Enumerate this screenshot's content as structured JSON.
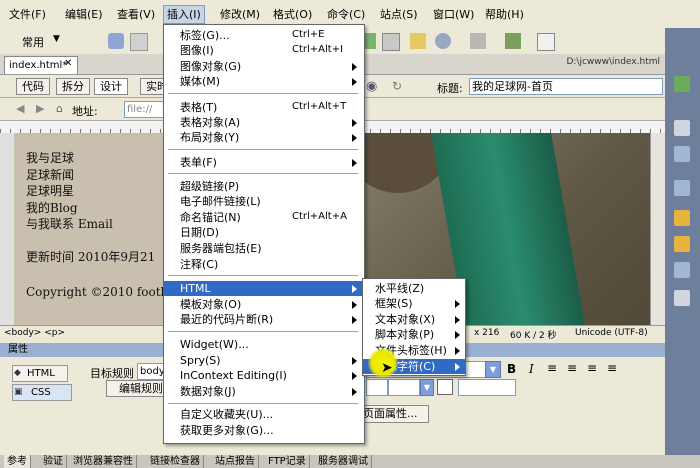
{
  "menubar": {
    "items": [
      "文件(F)",
      "编辑(E)",
      "查看(V)",
      "插入(I)",
      "修改(M)",
      "格式(O)",
      "命令(C)",
      "站点(S)",
      "窗口(W)",
      "帮助(H)"
    ]
  },
  "toolbar": {
    "category": "常用"
  },
  "document": {
    "tab": "index.html*",
    "path": "D:\\jcwww\\index.html"
  },
  "view": {
    "code": "代码",
    "split": "拆分",
    "design": "设计",
    "live": "实时",
    "title_label": "标题:",
    "title_value": "我的足球网-首页"
  },
  "address": {
    "label": "地址:",
    "value": "file://"
  },
  "page": {
    "nav": [
      "我与足球",
      "足球新闻",
      "足球明星",
      "我的Blog",
      "与我联系 Email"
    ],
    "update": "更新时间 2010年9月21",
    "copyright": "Copyright ©2010 football"
  },
  "status": {
    "tag_path": "<body> <p>",
    "size": "x 216",
    "weight": "60 K / 2 秒",
    "encoding": "Unicode (UTF-8)"
  },
  "properties": {
    "header": "属性",
    "html": "HTML",
    "css": "CSS",
    "target_rule_label": "目标规则",
    "target_rule_value": "body",
    "edit_rule": "编辑规则",
    "page_props": "页面属性..."
  },
  "insert_menu": {
    "items": [
      {
        "label": "标签(G)...",
        "shortcut": "Ctrl+E"
      },
      {
        "label": "图像(I)",
        "shortcut": "Ctrl+Alt+I"
      },
      {
        "label": "图像对象(G)",
        "submenu": true
      },
      {
        "label": "媒体(M)",
        "submenu": true
      },
      {
        "label": "表格(T)",
        "shortcut": "Ctrl+Alt+T"
      },
      {
        "label": "表格对象(A)",
        "submenu": true
      },
      {
        "label": "布局对象(Y)",
        "submenu": true
      },
      {
        "label": "表单(F)",
        "submenu": true
      },
      {
        "label": "超级链接(P)"
      },
      {
        "label": "电子邮件链接(L)"
      },
      {
        "label": "命名锚记(N)",
        "shortcut": "Ctrl+Alt+A"
      },
      {
        "label": "日期(D)"
      },
      {
        "label": "服务器端包括(E)"
      },
      {
        "label": "注释(C)"
      },
      {
        "label": "HTML",
        "submenu": true
      },
      {
        "label": "模板对象(O)",
        "submenu": true
      },
      {
        "label": "最近的代码片断(R)",
        "submenu": true
      },
      {
        "label": "Widget(W)..."
      },
      {
        "label": "Spry(S)",
        "submenu": true
      },
      {
        "label": "InContext Editing(I)",
        "submenu": true
      },
      {
        "label": "数据对象(J)",
        "submenu": true
      },
      {
        "label": "自定义收藏夹(U)..."
      },
      {
        "label": "获取更多对象(G)..."
      }
    ]
  },
  "html_submenu": {
    "items": [
      {
        "label": "水平线(Z)"
      },
      {
        "label": "框架(S)",
        "submenu": true
      },
      {
        "label": "文本对象(X)",
        "submenu": true
      },
      {
        "label": "脚本对象(P)",
        "submenu": true
      },
      {
        "label": "文件头标签(H)",
        "submenu": true
      },
      {
        "label": "特殊字符(C)",
        "submenu": true
      }
    ]
  },
  "bottom_tabs": [
    "参考",
    "验证",
    "浏览器兼容性",
    "链接检查器",
    "站点报告",
    "FTP记录",
    "服务器调试"
  ],
  "colors": {
    "highlight": "#316ac5",
    "menubar": "#ece9d8",
    "cursor_glow": "#f2f200"
  }
}
